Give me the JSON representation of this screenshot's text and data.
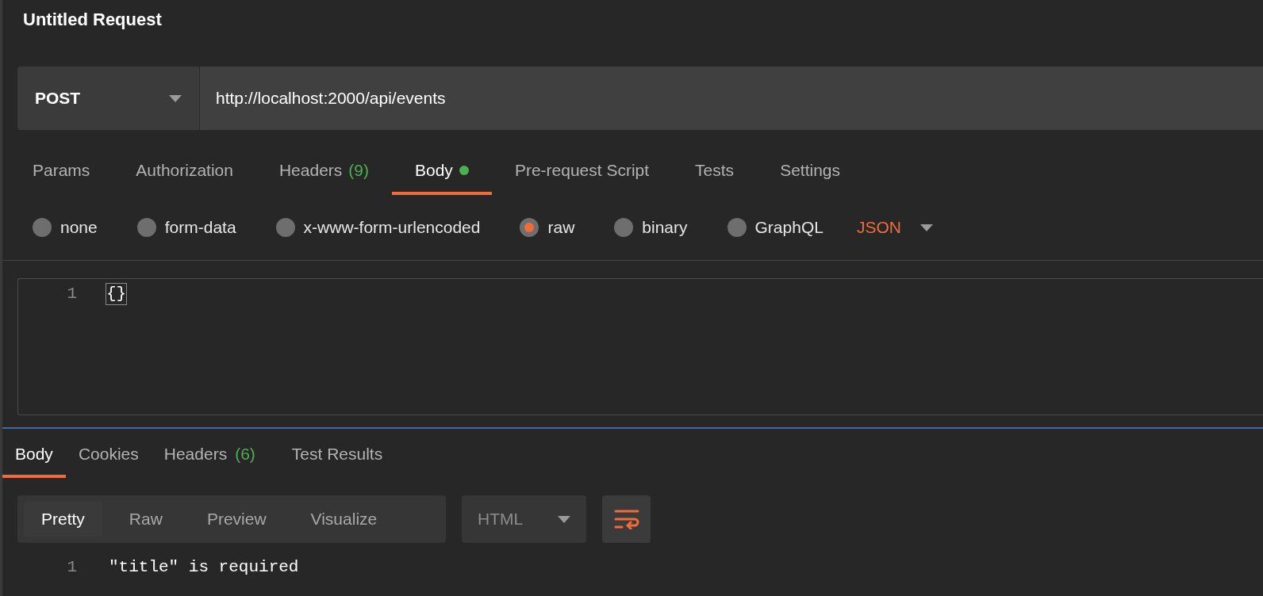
{
  "title": "Untitled Request",
  "request": {
    "method": "POST",
    "url": "http://localhost:2000/api/events"
  },
  "request_tabs": [
    {
      "label": "Params",
      "selected": false,
      "dot": false
    },
    {
      "label": "Authorization",
      "selected": false,
      "dot": false
    },
    {
      "label": "Headers",
      "count": "(9)",
      "selected": false,
      "dot": false
    },
    {
      "label": "Body",
      "selected": true,
      "dot": true
    },
    {
      "label": "Pre-request Script",
      "selected": false,
      "dot": false
    },
    {
      "label": "Tests",
      "selected": false,
      "dot": false
    },
    {
      "label": "Settings",
      "selected": false,
      "dot": false
    }
  ],
  "body_types": [
    {
      "label": "none",
      "selected": false
    },
    {
      "label": "form-data",
      "selected": false
    },
    {
      "label": "x-www-form-urlencoded",
      "selected": false
    },
    {
      "label": "raw",
      "selected": true
    },
    {
      "label": "binary",
      "selected": false
    },
    {
      "label": "GraphQL",
      "selected": false
    }
  ],
  "raw_format": "JSON",
  "editor": {
    "lines": [
      {
        "number": "1",
        "code": "{}"
      }
    ]
  },
  "response_tabs": [
    {
      "label": "Body",
      "selected": true
    },
    {
      "label": "Cookies",
      "selected": false
    },
    {
      "label": "Headers",
      "count": "(6)",
      "selected": false
    },
    {
      "label": "Test Results",
      "selected": false
    }
  ],
  "view_modes": [
    {
      "label": "Pretty",
      "selected": true
    },
    {
      "label": "Raw",
      "selected": false
    },
    {
      "label": "Preview",
      "selected": false
    },
    {
      "label": "Visualize",
      "selected": false
    }
  ],
  "response_format": "HTML",
  "response": {
    "lines": [
      {
        "number": "1",
        "code": "\"title\" is required"
      }
    ]
  }
}
